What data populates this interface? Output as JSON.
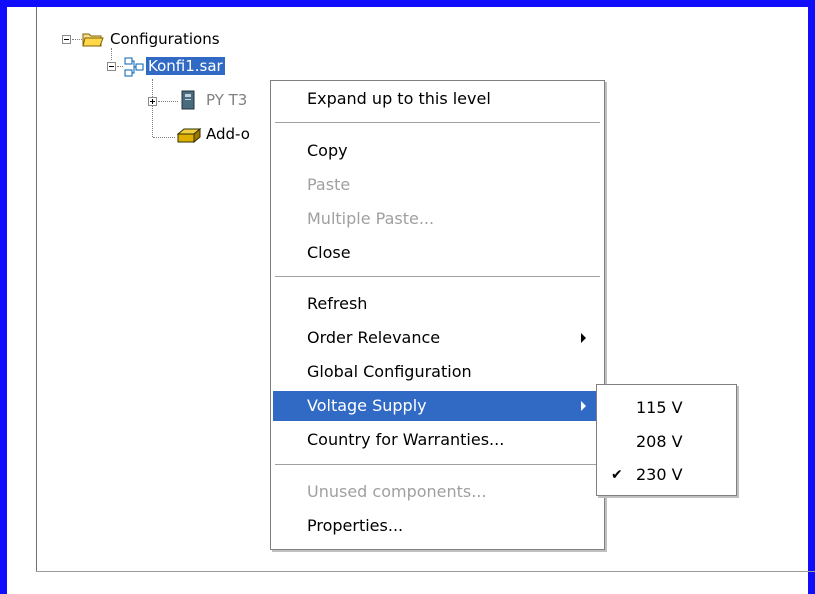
{
  "tree": {
    "root_label": "Configurations",
    "config_label": "Konfi1.sar",
    "child1_label": "PY T3",
    "child2_label": "Add-o"
  },
  "context_menu": {
    "items": [
      {
        "label": "Expand up to this level",
        "enabled": true
      },
      {
        "label": "Copy",
        "enabled": true
      },
      {
        "label": "Paste",
        "enabled": false
      },
      {
        "label": "Multiple Paste...",
        "enabled": false
      },
      {
        "label": "Close",
        "enabled": true
      },
      {
        "label": "Refresh",
        "enabled": true
      },
      {
        "label": "Order Relevance",
        "enabled": true,
        "submenu": true
      },
      {
        "label": "Global Configuration",
        "enabled": true
      },
      {
        "label": "Voltage Supply",
        "enabled": true,
        "submenu": true,
        "highlighted": true
      },
      {
        "label": "Country for Warranties...",
        "enabled": true
      },
      {
        "label": "Unused components...",
        "enabled": false
      },
      {
        "label": "Properties...",
        "enabled": true
      }
    ]
  },
  "voltage_submenu": {
    "items": [
      {
        "label": "115 V",
        "checked": false
      },
      {
        "label": "208 V",
        "checked": false
      },
      {
        "label": "230 V",
        "checked": true
      }
    ],
    "check_mark": "✔"
  },
  "colors": {
    "frame": "#0f0dfc",
    "selection": "#316ac5"
  }
}
